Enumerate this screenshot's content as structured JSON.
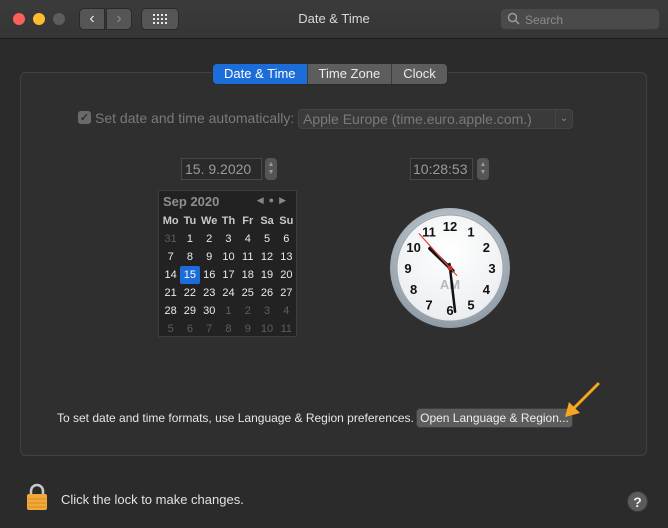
{
  "window": {
    "title": "Date & Time"
  },
  "toolbar": {
    "back_glyph": "‹",
    "forward_glyph": "›"
  },
  "search": {
    "placeholder": "Search",
    "value": ""
  },
  "tabs": [
    {
      "label": "Date & Time",
      "selected": true
    },
    {
      "label": "Time Zone",
      "selected": false
    },
    {
      "label": "Clock",
      "selected": false
    }
  ],
  "auto": {
    "checked": true,
    "check_glyph": "✓",
    "label": "Set date and time automatically:",
    "server": "Apple Europe (time.euro.apple.com.)"
  },
  "date_field": "15.  9.2020",
  "time_field": "10:28:53",
  "calendar": {
    "month": "Sep 2020",
    "weekdays": [
      "Mo",
      "Tu",
      "We",
      "Th",
      "Fr",
      "Sa",
      "Su"
    ],
    "selected_day": "15",
    "weeks": [
      [
        "31",
        "1",
        "2",
        "3",
        "4",
        "5",
        "6"
      ],
      [
        "7",
        "8",
        "9",
        "10",
        "11",
        "12",
        "13"
      ],
      [
        "14",
        "15",
        "16",
        "17",
        "18",
        "19",
        "20"
      ],
      [
        "21",
        "22",
        "23",
        "24",
        "25",
        "26",
        "27"
      ],
      [
        "28",
        "29",
        "30",
        "1",
        "2",
        "3",
        "4"
      ],
      [
        "5",
        "6",
        "7",
        "8",
        "9",
        "10",
        "11"
      ]
    ],
    "dim_cells": [
      [
        0,
        0
      ],
      [
        4,
        3
      ],
      [
        4,
        4
      ],
      [
        4,
        5
      ],
      [
        4,
        6
      ],
      [
        5,
        0
      ],
      [
        5,
        1
      ],
      [
        5,
        2
      ],
      [
        5,
        3
      ],
      [
        5,
        4
      ],
      [
        5,
        5
      ],
      [
        5,
        6
      ]
    ]
  },
  "clock": {
    "am_pm": "AM",
    "numbers": [
      "12",
      "1",
      "2",
      "3",
      "4",
      "5",
      "6",
      "7",
      "8",
      "9",
      "10",
      "11"
    ],
    "hours": 10,
    "minutes": 28,
    "seconds": 53
  },
  "formats": {
    "text": "To set date and time formats, use Language & Region preferences.",
    "button": "Open Language & Region..."
  },
  "lock": {
    "text": "Click the lock to make changes."
  },
  "help": {
    "label": "?"
  },
  "colors": {
    "accent": "#1b6ed9",
    "annotation_arrow": "#f5a623",
    "lock": "#f2a93b"
  }
}
